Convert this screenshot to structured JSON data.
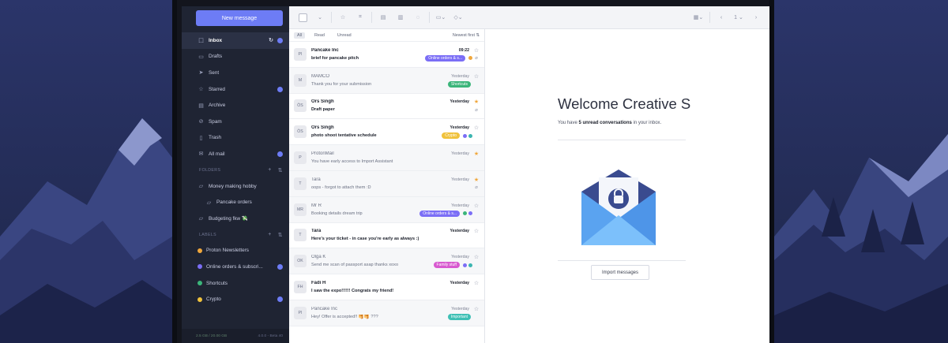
{
  "sidebar": {
    "new_message": "New message",
    "nav": [
      {
        "label": "Inbox",
        "icon": "inbox-icon"
      },
      {
        "label": "Drafts",
        "icon": "drafts-icon"
      },
      {
        "label": "Sent",
        "icon": "sent-icon"
      },
      {
        "label": "Starred",
        "icon": "star-icon"
      },
      {
        "label": "Archive",
        "icon": "archive-icon"
      },
      {
        "label": "Spam",
        "icon": "spam-icon"
      },
      {
        "label": "Trash",
        "icon": "trash-icon"
      },
      {
        "label": "All mail",
        "icon": "all-mail-icon"
      }
    ],
    "folders_header": "FOLDERS",
    "folders": [
      {
        "label": "Money making hobby"
      },
      {
        "label": "Pancake orders"
      },
      {
        "label": "Budgeting fkw 💸"
      }
    ],
    "labels_header": "LABELS",
    "labels": [
      {
        "label": "Proton Newsletters",
        "color": "#f0a73c"
      },
      {
        "label": "Online orders & subscri...",
        "color": "#7b6ef6"
      },
      {
        "label": "Shortcuts",
        "color": "#3bb57a"
      },
      {
        "label": "Crypto",
        "color": "#f0c23c"
      }
    ],
    "storage": "2.5 GB / 20.00 GB",
    "version": "4.0.0 - Beta 40"
  },
  "toolbar": {
    "pagination": "1"
  },
  "filters": {
    "all": "All",
    "read": "Read",
    "unread": "Unread",
    "sort": "Newest first"
  },
  "messages": [
    {
      "initials": "PI",
      "sender": "Pancake Inc",
      "subject": "brief for pancake pitch",
      "time": "09:22",
      "unread": true,
      "star": false,
      "tag": "Online orders & s...",
      "tag_color": "#7b6ef6",
      "dots": [
        "#f0a73c"
      ],
      "attach": true
    },
    {
      "initials": "M",
      "sender": "MAMCO",
      "subject": "Thank you for your submission",
      "time": "Yesterday",
      "unread": false,
      "star": false,
      "tag": "Shortcuts",
      "tag_color": "#3bb57a",
      "dots": [],
      "attach": false
    },
    {
      "initials": "ÖS",
      "sender": "Örs Singh",
      "subject": "Draft paper",
      "time": "Yesterday",
      "unread": true,
      "star": true,
      "tag": "",
      "tag_color": "",
      "dots": [],
      "attach": true
    },
    {
      "initials": "ÖS",
      "sender": "Örs Singh",
      "subject": "photo shoot tentative schedule",
      "time": "Yesterday",
      "unread": true,
      "star": false,
      "tag": "Crypto",
      "tag_color": "#f0c23c",
      "dots": [
        "#7b6ef6",
        "#3bb5b0"
      ],
      "attach": false
    },
    {
      "initials": "P",
      "sender": "ProtonMail",
      "subject": "You have early access to Import Assistant",
      "time": "Yesterday",
      "unread": false,
      "star": true,
      "tag": "",
      "tag_color": "",
      "dots": [],
      "attach": false
    },
    {
      "initials": "T",
      "sender": "Tara",
      "subject": "oops - forgot to attach them :D",
      "time": "Yesterday",
      "unread": false,
      "star": true,
      "tag": "",
      "tag_color": "",
      "dots": [],
      "attach": true
    },
    {
      "initials": "MR",
      "sender": "Mr R",
      "subject": "Booking details dream trip",
      "time": "Yesterday",
      "unread": false,
      "star": false,
      "tag": "Online orders & s...",
      "tag_color": "#7b6ef6",
      "dots": [
        "#3bb57a",
        "#7b6ef6"
      ],
      "attach": false
    },
    {
      "initials": "T",
      "sender": "Tara",
      "subject": "Here's your ticket - in case you're early as always :)",
      "time": "Yesterday",
      "unread": true,
      "star": false,
      "tag": "",
      "tag_color": "",
      "dots": [],
      "attach": false
    },
    {
      "initials": "OK",
      "sender": "Olga K",
      "subject": "Send me scan of passport asap thanks xoxo",
      "time": "Yesterday",
      "unread": false,
      "star": false,
      "tag": "Family stuff",
      "tag_color": "#d85ad0",
      "dots": [
        "#7b6ef6",
        "#3bb5b0"
      ],
      "attach": false
    },
    {
      "initials": "FH",
      "sender": "Fadi H",
      "subject": "I saw the expo!!!!!! Congrats my friend!",
      "time": "Yesterday",
      "unread": true,
      "star": false,
      "tag": "",
      "tag_color": "",
      "dots": [],
      "attach": false
    },
    {
      "initials": "PI",
      "sender": "Pancake Inc",
      "subject": "Hey! Offer is accepted!! 🥞🥞 ???",
      "time": "Yesterday",
      "unread": false,
      "star": false,
      "tag": "Important",
      "tag_color": "#3ec0b5",
      "dots": [],
      "attach": false
    }
  ],
  "reader": {
    "welcome": "Welcome Creative S",
    "note_pre": "You have ",
    "note_bold": "5 unread conversations",
    "note_post": " in your inbox.",
    "import_button": "Import messages"
  },
  "colors": {
    "accent": "#6d7cf5",
    "sidebar_bg": "#1f2433",
    "page_bg": "#27305a"
  }
}
